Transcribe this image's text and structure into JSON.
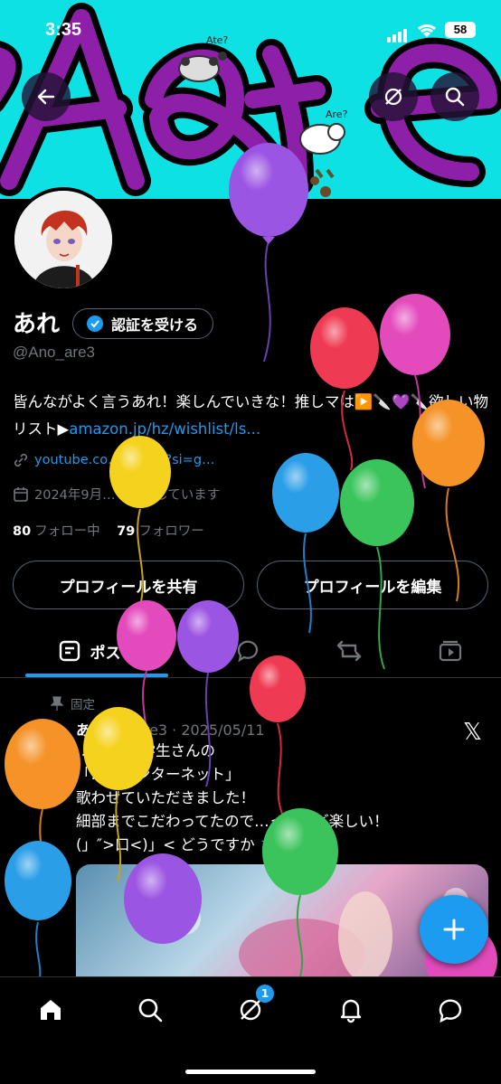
{
  "status": {
    "time": "3:35",
    "battery": "58"
  },
  "banner": {
    "doodle_text": "Ate?",
    "doodle_text2": "Are?"
  },
  "profile": {
    "name": "あれ",
    "verify_label": "認証を受ける",
    "handle": "@Ano_are3",
    "bio_text": "皆んながよく言うあれ！楽しんでいきな！推しマは▶️🔪💜🔪欲しい物リスト▶",
    "bio_link": "amazon.jp/hz/wishlist/ls...",
    "website": "youtube.co…o_are3?si=g…",
    "joined": "2024年9月…を利用しています",
    "following_count": "80",
    "following_label": "フォロー中",
    "followers_count": "79",
    "followers_label": "フォロワー"
  },
  "buttons": {
    "share": "プロフィールを共有",
    "edit": "プロフィールを編集"
  },
  "tabs": {
    "posts": "ポスト"
  },
  "post": {
    "pinned_label": "固定",
    "author": "あ",
    "meta": "…no_are3 · 2025/05/11",
    "line1": "…編曲:超学生さんの",
    "line2": "「…グインターネット」",
    "line3": "歌わせていただきました！",
    "line4": "細部までこだわってたので…ったけど楽しい！",
    "line5": "(」″>口<)」< どうですか",
    "line5_link": "さ"
  },
  "nav": {
    "notif_badge": "1"
  },
  "colors": {
    "accent": "#1d9bf0",
    "banner": "#0de1e3",
    "banner_text": "#8e1fa8"
  }
}
